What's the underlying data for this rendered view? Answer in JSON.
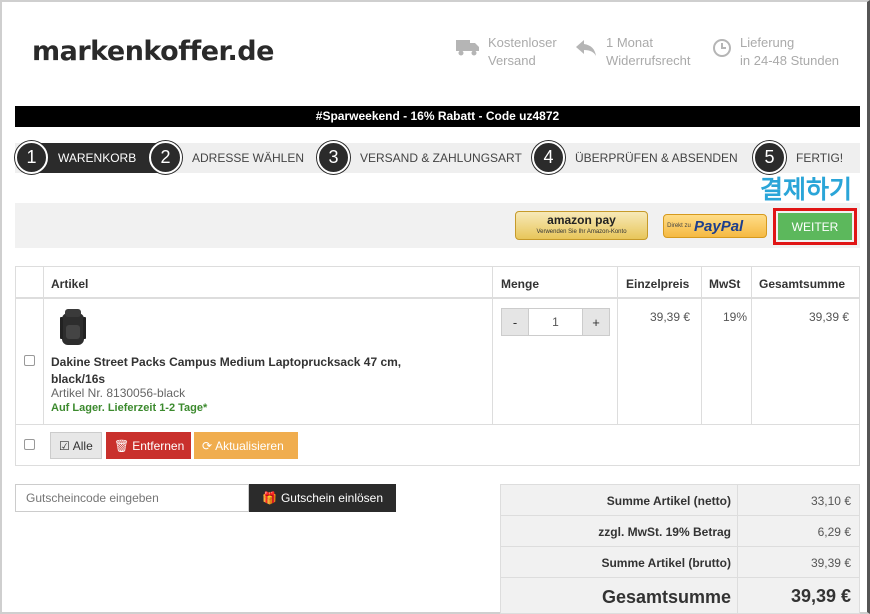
{
  "brand": {
    "logo_text": "markenkoffer.de"
  },
  "usps": [
    {
      "icon": "truck-icon",
      "line1": "Kostenloser",
      "line2": "Versand"
    },
    {
      "icon": "return-arrow-icon",
      "line1": "1 Monat",
      "line2": "Widerrufsrecht"
    },
    {
      "icon": "clock-icon",
      "line1": "Lieferung",
      "line2": "in 24-48 Stunden"
    }
  ],
  "promo": "#Sparweekend - 16% Rabatt - Code uz4872",
  "steps": [
    {
      "num": "1",
      "label": "Warenkorb",
      "active": true
    },
    {
      "num": "2",
      "label": "Adresse wählen"
    },
    {
      "num": "3",
      "label": "Versand & Zahlungsart"
    },
    {
      "num": "4",
      "label": "Überprüfen & absenden"
    },
    {
      "num": "5",
      "label": "Fertig!"
    }
  ],
  "annotation_korean": "결제하기",
  "payment": {
    "amazon_label": "amazon pay",
    "amazon_sub": "Verwenden Sie Ihr Amazon-Konto",
    "paypal_prefix": "Direkt zu",
    "paypal_label": "PayPal",
    "weiter": "WEITER"
  },
  "cart": {
    "headers": {
      "artikel": "Artikel",
      "menge": "Menge",
      "einzelpreis": "Einzelpreis",
      "mwst": "MwSt",
      "gesamt": "Gesamtsumme"
    },
    "items": [
      {
        "name": "Dakine Street Packs Campus Medium Laptoprucksack 47 cm, black/16s",
        "article_no": "Artikel Nr. 8130056-black",
        "stock": "Auf Lager. Lieferzeit 1-2 Tage*",
        "qty": "1",
        "qty_minus": "-",
        "qty_plus": "+",
        "unit_price": "39,39 €",
        "vat": "19%",
        "total": "39,39 €"
      }
    ],
    "actions": {
      "all": "Alle",
      "remove": "Entfernen",
      "update": "Aktualisieren"
    }
  },
  "coupon": {
    "placeholder": "Gutscheincode eingeben",
    "button": "Gutschein einlösen"
  },
  "summary": [
    {
      "label": "Summe Artikel (netto)",
      "value": "33,10 €"
    },
    {
      "label": "zzgl. MwSt. 19% Betrag",
      "value": "6,29 €"
    },
    {
      "label": "Summe Artikel (brutto)",
      "value": "39,39 €"
    },
    {
      "label": "Gesamtsumme",
      "value": "39,39 €"
    }
  ]
}
